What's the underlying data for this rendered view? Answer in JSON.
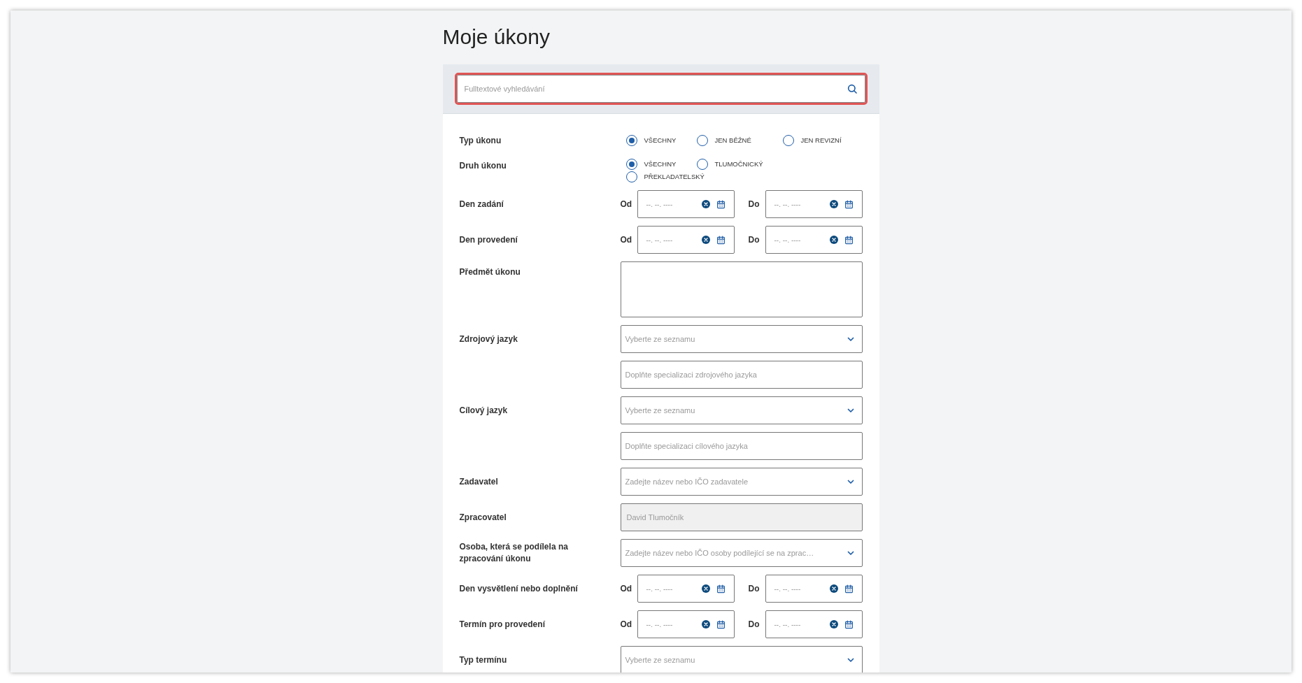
{
  "title": "Moje úkony",
  "search": {
    "placeholder": "Fulltextové vyhledávání",
    "highlighted": true
  },
  "rows": [
    {
      "kind": "radio_inline",
      "label": "Typ úkonu",
      "options": [
        {
          "label": "VŠECHNY",
          "selected": true
        },
        {
          "label": "JEN BĚŽNÉ",
          "selected": false
        },
        {
          "label": "JEN REVIZNÍ",
          "selected": false
        }
      ]
    },
    {
      "kind": "radio_wrap",
      "label": "Druh úkonu",
      "options": [
        {
          "label": "VŠECHNY",
          "selected": true
        },
        {
          "label": "TLUMOČNICKÝ",
          "selected": false
        },
        {
          "label": "PŘEKLADATELSKÝ",
          "selected": false
        }
      ]
    },
    {
      "kind": "date_range",
      "label": "Den zadání",
      "from_label": "Od",
      "from_placeholder": "--. --. ----",
      "to_label": "Do",
      "to_placeholder": "--. --. ----"
    },
    {
      "kind": "date_range",
      "label": "Den provedení",
      "from_label": "Od",
      "from_placeholder": "--. --. ----",
      "to_label": "Do",
      "to_placeholder": "--. --. ----"
    },
    {
      "kind": "textarea",
      "label": "Předmět úkonu"
    },
    {
      "kind": "select",
      "label": "Zdrojový jazyk",
      "placeholder": "Vyberte ze seznamu"
    },
    {
      "kind": "text",
      "placeholder": "Doplňte specializaci zdrojového jazyka"
    },
    {
      "kind": "select",
      "label": "Cílový jazyk",
      "placeholder": "Vyberte ze seznamu"
    },
    {
      "kind": "text",
      "placeholder": "Doplňte specializaci cílového jazyka"
    },
    {
      "kind": "select",
      "label": "Zadavatel",
      "placeholder": "Zadejte název nebo IČO zadavatele"
    },
    {
      "kind": "readonly",
      "label": "Zpracovatel",
      "value": "David Tlumočník"
    },
    {
      "kind": "select",
      "label": "Osoba, která se podílela na zpracování úkonu",
      "placeholder": "Zadejte název nebo IČO osoby podílející se na zprac…"
    },
    {
      "kind": "date_range",
      "label": "Den vysvětlení nebo doplnění",
      "from_label": "Od",
      "from_placeholder": "--. --. ----",
      "to_label": "Do",
      "to_placeholder": "--. --. ----"
    },
    {
      "kind": "date_range",
      "label": "Termín pro provedení",
      "from_label": "Od",
      "from_placeholder": "--. --. ----",
      "to_label": "Do",
      "to_placeholder": "--. --. ----"
    },
    {
      "kind": "select",
      "label": "Typ termínu",
      "placeholder": "Vyberte ze seznamu"
    }
  ]
}
